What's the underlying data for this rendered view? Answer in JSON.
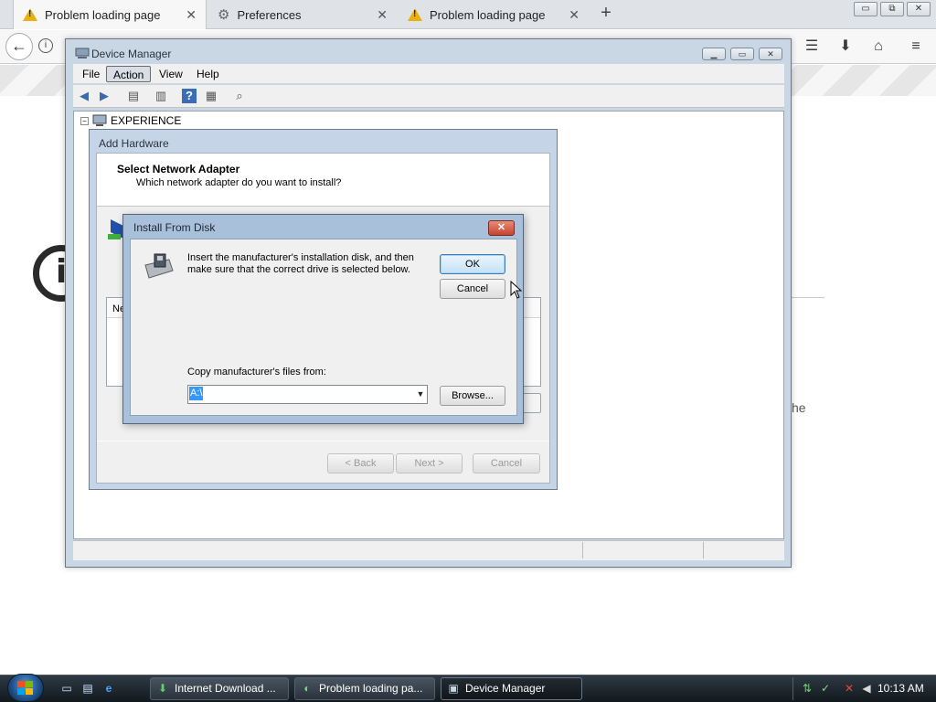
{
  "browser": {
    "tabs": [
      {
        "label": "Problem loading page",
        "icon": "warning-icon",
        "active": true
      },
      {
        "label": "Preferences",
        "icon": "gear-icon",
        "active": false
      },
      {
        "label": "Problem loading page",
        "icon": "warning-icon",
        "active": false
      }
    ],
    "new_tab_glyph": "+",
    "close_glyph": "✕",
    "window_controls": {
      "minimize": "▭",
      "restore": "⧉",
      "close": "✕"
    },
    "error_fragment": "he"
  },
  "device_manager": {
    "title": "Device Manager",
    "menu": [
      "File",
      "Action",
      "View",
      "Help"
    ],
    "tree_root": "EXPERIENCE"
  },
  "add_hardware": {
    "title": "Add Hardware",
    "heading": "Select Network Adapter",
    "subheading": "Which network adapter do you want to install?",
    "list_header_fragment": "Ne",
    "buttons": {
      "back": "< Back",
      "next": "Next >",
      "cancel": "Cancel"
    }
  },
  "install_from_disk": {
    "title": "Install From Disk",
    "close_glyph": "✕",
    "message": "Insert the manufacturer's installation disk, and then make sure that the correct drive is selected below.",
    "ok_label": "OK",
    "cancel_label": "Cancel",
    "copy_label": "Copy manufacturer's files from:",
    "path_value": "A:\\",
    "browse_label": "Browse..."
  },
  "taskbar": {
    "tasks": [
      {
        "label": "Internet Download ...",
        "active": false
      },
      {
        "label": "Problem loading pa...",
        "active": false
      },
      {
        "label": "Device Manager",
        "active": true
      }
    ],
    "clock": "10:13 AM"
  },
  "colors": {
    "vista_accent": "#3399ff",
    "warning_yellow": "#e8b10f",
    "close_red": "#c54430"
  }
}
